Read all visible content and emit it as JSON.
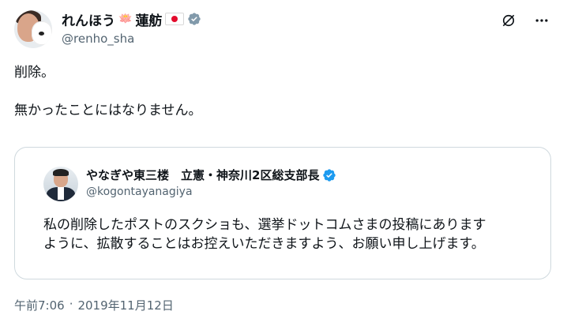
{
  "author": {
    "display_name": "れんほう",
    "name_suffix": "蓮舫",
    "lotus_emoji": "🪷",
    "handle": "@renho_sha",
    "verified_color": "#829aab"
  },
  "post": {
    "lines": [
      "削除。",
      "",
      "無かったことにはなりません。"
    ]
  },
  "quoted": {
    "display_name": "やなぎや東三楼　立憲・神奈川2区総支部長",
    "handle": "@kogontayanagiya",
    "verified_color": "#1d9bf0",
    "lines": [
      "私の削除したポストのスクショも、選挙ドットコムさまの投稿にあります",
      "ように、拡散することはお控えいただきますよう、お願い申し上げます。"
    ]
  },
  "meta": {
    "time": "午前7:06",
    "separator": "·",
    "date": "2019年11月12日"
  },
  "colors": {
    "text": "#0f1419",
    "secondary": "#536471",
    "border": "#cfd9de"
  },
  "icons": [
    "grok-icon",
    "more-icon"
  ]
}
